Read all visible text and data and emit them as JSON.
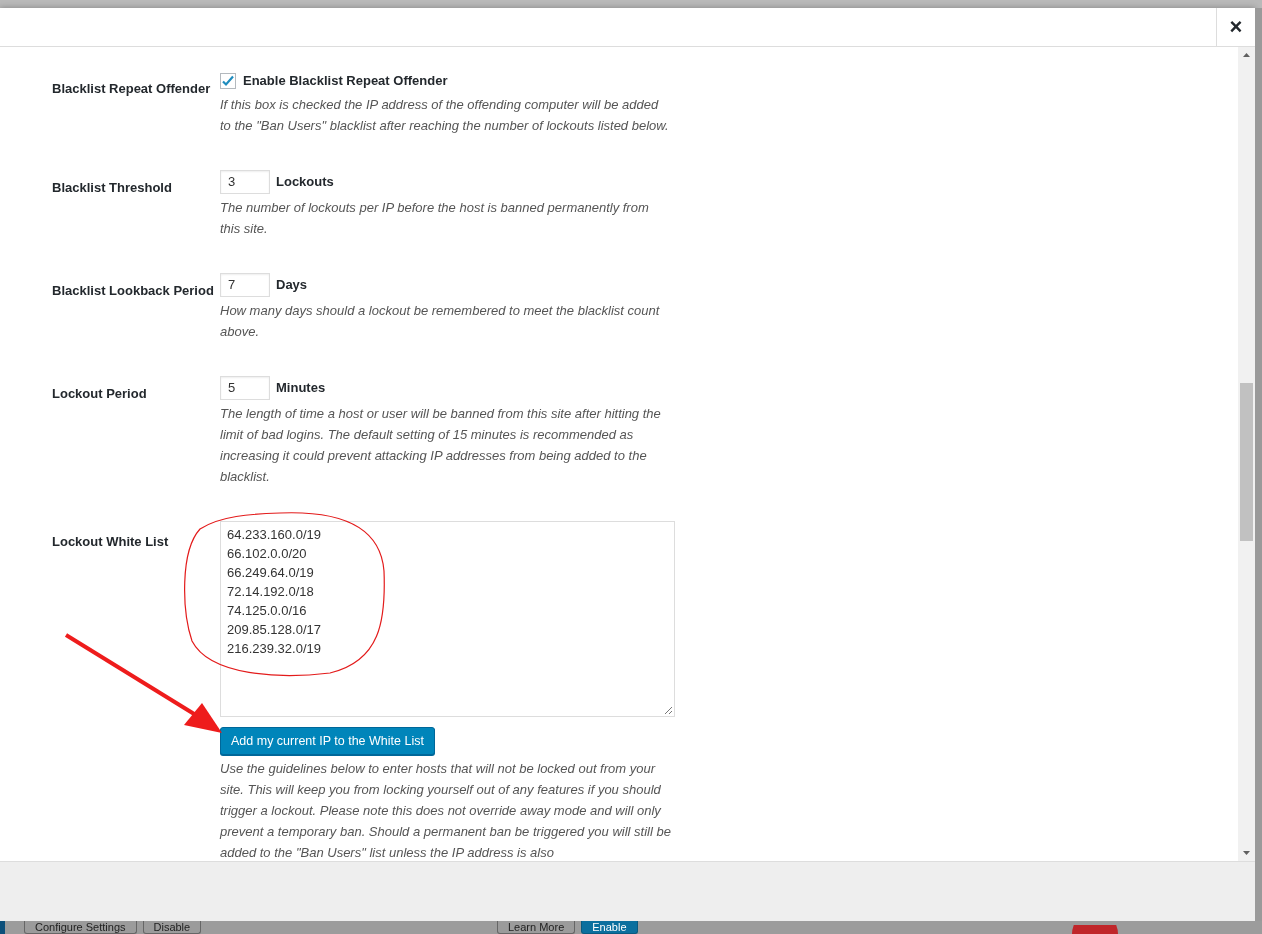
{
  "dialog": {
    "close": "×"
  },
  "settings": [
    {
      "kind": "checkbox",
      "label": "Blacklist Repeat Offender",
      "checked": true,
      "option": "Enable Blacklist Repeat Offender",
      "description": "If this box is checked the IP address of the offending computer will be added to the \"Ban Users\" blacklist after reaching the number of lockouts listed below."
    },
    {
      "kind": "number",
      "label": "Blacklist Threshold",
      "value": "3",
      "unit": "Lockouts",
      "description": "The number of lockouts per IP before the host is banned permanently from this site."
    },
    {
      "kind": "number",
      "label": "Blacklist Lookback Period",
      "value": "7",
      "unit": "Days",
      "description": "How many days should a lockout be remembered to meet the blacklist count above."
    },
    {
      "kind": "number",
      "label": "Lockout Period",
      "value": "5",
      "unit": "Minutes",
      "description": "The length of time a host or user will be banned from this site after hitting the limit of bad logins. The default setting of 15 minutes is recommended as increasing it could prevent attacking IP addresses from being added to the blacklist."
    },
    {
      "kind": "textarea",
      "label": "Lockout White List",
      "lines": [
        "64.233.160.0/19",
        "66.102.0.0/20",
        "66.249.64.0/19",
        "72.14.192.0/18",
        "74.125.0.0/16",
        "209.85.128.0/17",
        "216.239.32.0/19"
      ],
      "button": "Add my current IP to the White List",
      "description": "Use the guidelines below to enter hosts that will not be locked out from your site. This will keep you from locking yourself out of any features if you should trigger a lockout. Please note this does not override away mode and will only prevent a temporary ban. Should a permanent ban be triggered you will still be added to the \"Ban Users\" list unless the IP address is also"
    }
  ],
  "background_buttons": [
    {
      "label": "Configure Settings",
      "primary": false
    },
    {
      "label": "Disable",
      "primary": false
    },
    {
      "label": "Learn More",
      "primary": false
    },
    {
      "label": "Enable",
      "primary": true
    }
  ]
}
